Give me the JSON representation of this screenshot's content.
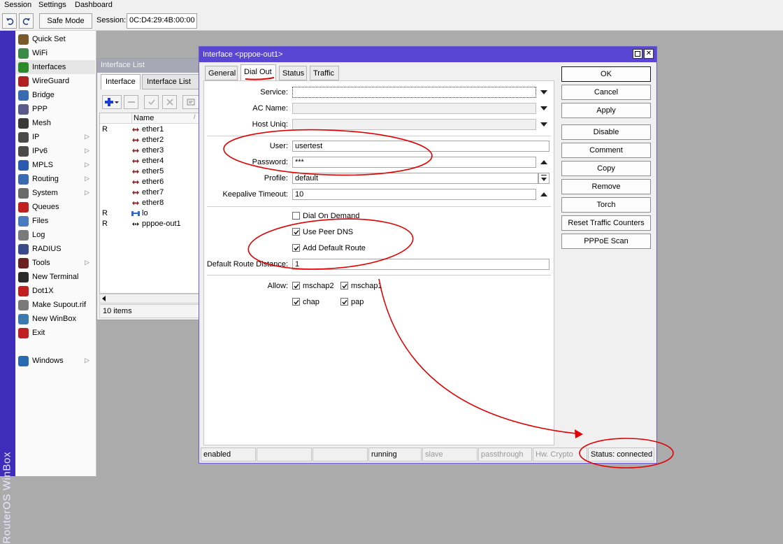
{
  "menu": [
    "Session",
    "Settings",
    "Dashboard"
  ],
  "toolbar": {
    "safe_mode": "Safe Mode",
    "session_label": "Session:",
    "session_value": "0C:D4:29:4B:00:00"
  },
  "brand": "RouterOS WinBox",
  "sidebar": {
    "items": [
      {
        "label": "Quick Set",
        "icon": "wand-icon",
        "arrow": false
      },
      {
        "label": "WiFi",
        "icon": "wifi-icon",
        "arrow": false
      },
      {
        "label": "Interfaces",
        "icon": "interfaces-icon",
        "arrow": false
      },
      {
        "label": "WireGuard",
        "icon": "wireguard-icon",
        "arrow": false
      },
      {
        "label": "Bridge",
        "icon": "bridge-icon",
        "arrow": false
      },
      {
        "label": "PPP",
        "icon": "ppp-icon",
        "arrow": false
      },
      {
        "label": "Mesh",
        "icon": "mesh-icon",
        "arrow": false
      },
      {
        "label": "IP",
        "icon": "ip-icon",
        "arrow": true
      },
      {
        "label": "IPv6",
        "icon": "ipv6-icon",
        "arrow": true
      },
      {
        "label": "MPLS",
        "icon": "mpls-icon",
        "arrow": true
      },
      {
        "label": "Routing",
        "icon": "routing-icon",
        "arrow": true
      },
      {
        "label": "System",
        "icon": "gear-icon",
        "arrow": true
      },
      {
        "label": "Queues",
        "icon": "queues-icon",
        "arrow": false
      },
      {
        "label": "Files",
        "icon": "folder-icon",
        "arrow": false
      },
      {
        "label": "Log",
        "icon": "log-icon",
        "arrow": false
      },
      {
        "label": "RADIUS",
        "icon": "radius-icon",
        "arrow": false
      },
      {
        "label": "Tools",
        "icon": "tools-icon",
        "arrow": true
      },
      {
        "label": "New Terminal",
        "icon": "terminal-icon",
        "arrow": false
      },
      {
        "label": "Dot1X",
        "icon": "dot1x-icon",
        "arrow": false
      },
      {
        "label": "Make Supout.rif",
        "icon": "supout-icon",
        "arrow": false
      },
      {
        "label": "New WinBox",
        "icon": "winbox-icon",
        "arrow": false
      },
      {
        "label": "Exit",
        "icon": "exit-icon",
        "arrow": false
      }
    ],
    "windows": {
      "label": "Windows",
      "icon": "windows-icon",
      "arrow": true
    }
  },
  "iflist": {
    "title": "Interface List",
    "tabs": [
      "Interface",
      "Interface List"
    ],
    "column_name": "Name",
    "rows": [
      {
        "flag": "R",
        "name": "ether1",
        "kind": "ether"
      },
      {
        "flag": "",
        "name": "ether2",
        "kind": "ether"
      },
      {
        "flag": "",
        "name": "ether3",
        "kind": "ether"
      },
      {
        "flag": "",
        "name": "ether4",
        "kind": "ether"
      },
      {
        "flag": "",
        "name": "ether5",
        "kind": "ether"
      },
      {
        "flag": "",
        "name": "ether6",
        "kind": "ether"
      },
      {
        "flag": "",
        "name": "ether7",
        "kind": "ether"
      },
      {
        "flag": "",
        "name": "ether8",
        "kind": "ether"
      },
      {
        "flag": "R",
        "name": "lo",
        "kind": "loopback"
      },
      {
        "flag": "R",
        "name": "pppoe-out1",
        "kind": "pppoe"
      }
    ],
    "count": "10 items"
  },
  "dialog": {
    "title": "Interface <pppoe-out1>",
    "tabs": [
      "General",
      "Dial Out",
      "Status",
      "Traffic"
    ],
    "fields": {
      "service_label": "Service:",
      "service_value": "",
      "ac_name_label": "AC Name:",
      "ac_name_value": "",
      "host_uniq_label": "Host Uniq:",
      "host_uniq_value": "",
      "user_label": "User:",
      "user_value": "usertest",
      "password_label": "Password:",
      "password_value": "***",
      "profile_label": "Profile:",
      "profile_value": "default",
      "keepalive_label": "Keepalive Timeout:",
      "keepalive_value": "10",
      "dial_on_demand_label": "Dial On Demand",
      "dial_on_demand": false,
      "use_peer_dns_label": "Use Peer DNS",
      "use_peer_dns": true,
      "add_default_route_label": "Add Default Route",
      "add_default_route": true,
      "default_route_distance_label": "Default Route Distance:",
      "default_route_distance_value": "1",
      "allow_label": "Allow:",
      "allow": [
        {
          "label": "mschap2",
          "checked": true
        },
        {
          "label": "mschap1",
          "checked": true
        },
        {
          "label": "chap",
          "checked": true
        },
        {
          "label": "pap",
          "checked": true
        }
      ]
    },
    "buttons": [
      "OK",
      "Cancel",
      "Apply",
      "Disable",
      "Comment",
      "Copy",
      "Remove",
      "Torch",
      "Reset Traffic Counters",
      "PPPoE Scan"
    ],
    "status": [
      "enabled",
      "",
      "",
      "running",
      "slave",
      "passthrough",
      "Hw. Crypto",
      "Status: connected"
    ]
  },
  "colors": {
    "accent": "#5a46d2",
    "annotation": "#e00000",
    "brand_strip": "#3e2db8"
  }
}
